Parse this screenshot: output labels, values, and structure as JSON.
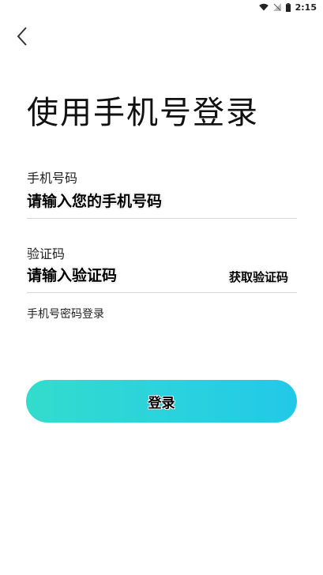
{
  "status_bar": {
    "time": "2:15"
  },
  "header": {
    "title": "使用手机号登录"
  },
  "form": {
    "phone": {
      "label": "手机号码",
      "placeholder": "请输入您的手机号码"
    },
    "code": {
      "label": "验证码",
      "placeholder": "请输入验证码",
      "get_code": "获取验证码"
    },
    "password_login": "手机号密码登录",
    "submit": "登录"
  },
  "colors": {
    "accent_start": "#33dccc",
    "accent_end": "#22c8e8"
  }
}
